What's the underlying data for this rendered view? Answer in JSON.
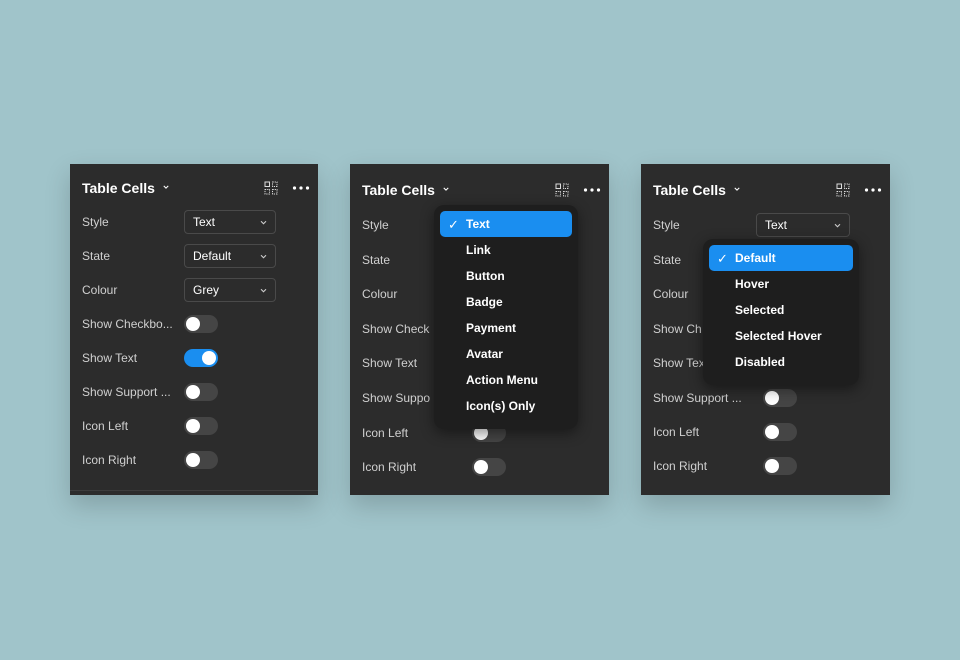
{
  "colors": {
    "background": "#a0c4ca",
    "panel": "#2c2c2c",
    "accent": "#1a8ef0"
  },
  "panel1": {
    "title": "Table Cells",
    "style": {
      "label": "Style",
      "value": "Text"
    },
    "state": {
      "label": "State",
      "value": "Default"
    },
    "colour": {
      "label": "Colour",
      "value": "Grey"
    },
    "show_checkbox": {
      "label": "Show Checkbo...",
      "on": false
    },
    "show_text": {
      "label": "Show Text",
      "on": true
    },
    "show_support": {
      "label": "Show Support ...",
      "on": false
    },
    "icon_left": {
      "label": "Icon Left",
      "on": false
    },
    "icon_right": {
      "label": "Icon Right",
      "on": false
    }
  },
  "panel2": {
    "title": "Table Cells",
    "labels": {
      "style": "Style",
      "state": "State",
      "colour": "Colour",
      "show_checkbox": "Show Check",
      "show_text": "Show Text",
      "show_support": "Show Suppo",
      "icon_left": "Icon Left",
      "icon_right": "Icon Right"
    },
    "dropdown": {
      "selected": "Text",
      "options": [
        "Text",
        "Link",
        "Button",
        "Badge",
        "Payment",
        "Avatar",
        "Action Menu",
        "Icon(s) Only"
      ]
    }
  },
  "panel3": {
    "title": "Table Cells",
    "style": {
      "label": "Style",
      "value": "Text"
    },
    "labels": {
      "state": "State",
      "colour": "Colour",
      "show_checkbox": "Show Ch",
      "show_text": "Show Tex",
      "show_support": "Show Support ...",
      "icon_left": "Icon Left",
      "icon_right": "Icon Right"
    },
    "dropdown": {
      "selected": "Default",
      "options": [
        "Default",
        "Hover",
        "Selected",
        "Selected Hover",
        "Disabled"
      ]
    }
  },
  "check_glyph": "✓"
}
